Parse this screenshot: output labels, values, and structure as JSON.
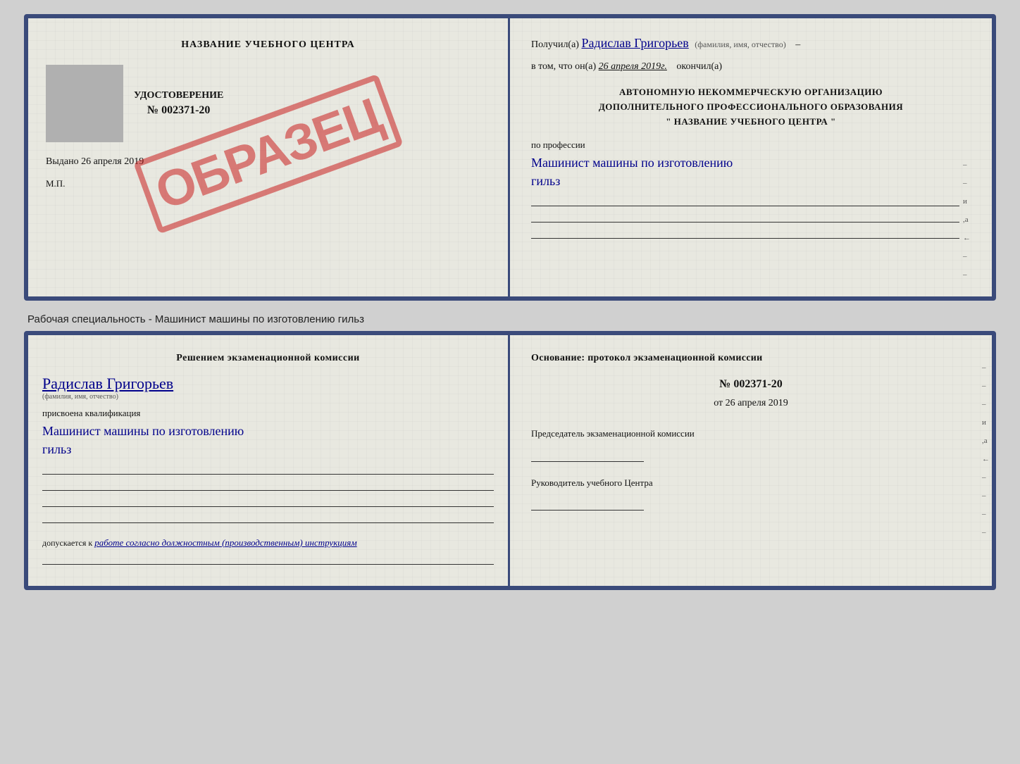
{
  "top_cert": {
    "left": {
      "title": "НАЗВАНИЕ УЧЕБНОГО ЦЕНТРА",
      "gray_box_label": "фото",
      "cert_label": "УДОСТОВЕРЕНИЕ",
      "cert_number_prefix": "№",
      "cert_number": "002371-20",
      "issued_label": "Выдано",
      "issued_date": "26 апреля 2019",
      "mp_label": "М.П.",
      "obrazec": "ОБРАЗЕЦ"
    },
    "right": {
      "received_prefix": "Получил(а)",
      "received_name": "Радислав Григорьев",
      "received_subtitle": "(фамилия, имя, отчество)",
      "date_prefix": "в том, что он(а)",
      "date_val": "26 апреля 2019г.",
      "date_suffix": "окончил(а)",
      "org_line1": "АВТОНОМНУЮ НЕКОММЕРЧЕСКУЮ ОРГАНИЗАЦИЮ",
      "org_line2": "ДОПОЛНИТЕЛЬНОГО ПРОФЕССИОНАЛЬНОГО ОБРАЗОВАНИЯ",
      "org_line3": "\"    НАЗВАНИЕ УЧЕБНОГО ЦЕНТРА    \"",
      "profession_label": "по профессии",
      "profession_val": "Машинист машины по изготовлению",
      "profession_val2": "гильз",
      "edge_marks": [
        "–",
        "–",
        "–",
        "–",
        "и",
        "а",
        "←",
        "–"
      ]
    }
  },
  "divider": {
    "text": "Рабочая специальность - Машинист машины по изготовлению гильз"
  },
  "bottom_cert": {
    "left": {
      "decision_title": "Решением  экзаменационной  комиссии",
      "person_name": "Радислав Григорьев",
      "person_subtitle": "(фамилия, имя, отчество)",
      "qualification_prefix": "присвоена квалификация",
      "qualification_val": "Машинист  машины  по изготовлению",
      "qualification_val2": "гильз",
      "allow_prefix": "допускается к",
      "allow_val": "работе согласно должностным (производственным) инструкциям"
    },
    "right": {
      "basis_title": "Основание:  протокол  экзаменационной  комиссии",
      "protocol_prefix": "№",
      "protocol_number": "002371-20",
      "date_prefix": "от",
      "date_val": "26 апреля 2019",
      "chair_label": "Председатель экзаменационной комиссии",
      "head_label": "Руководитель учебного Центра",
      "edge_marks": [
        "–",
        "–",
        "–",
        "–",
        "и",
        "а",
        "←",
        "–",
        "–",
        "–",
        "–"
      ]
    }
  }
}
